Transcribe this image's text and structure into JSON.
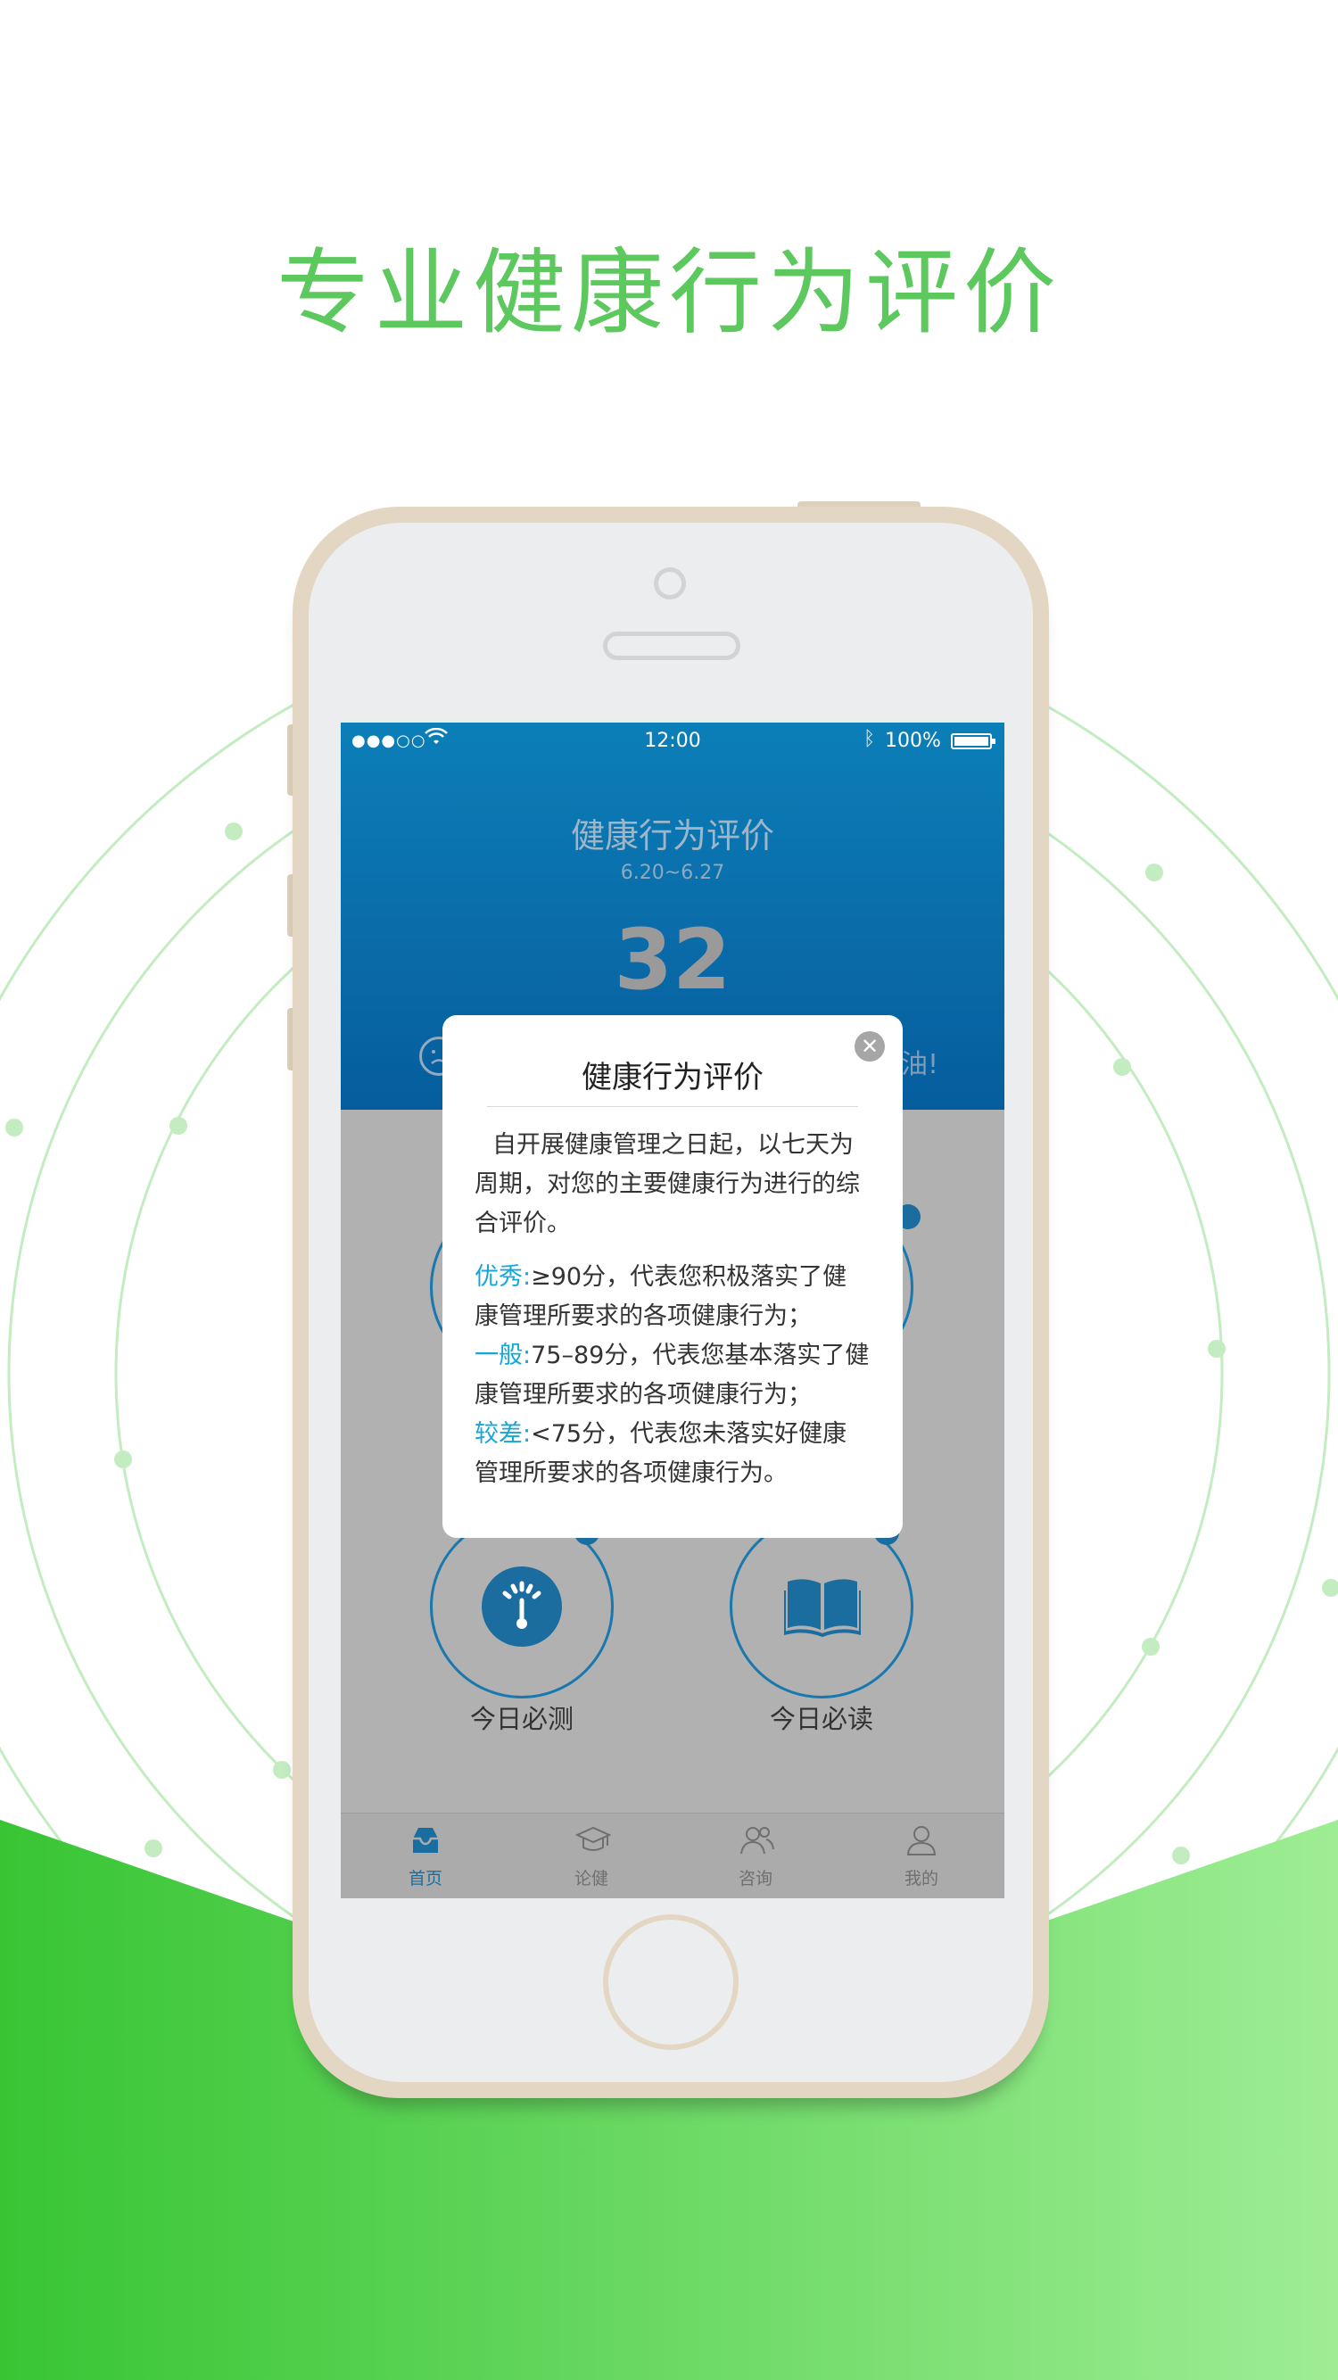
{
  "headline": "专业健康行为评价",
  "status_bar": {
    "signal": "●●●○○",
    "time": "12:00",
    "battery": "100%"
  },
  "app_header": {
    "title": "健康行为评价",
    "date_range": "6.20~6.27",
    "score": "32",
    "trailing_text": "油!"
  },
  "dialog": {
    "title": "健康行为评价",
    "intro": "自开展健康管理之日起，以七天为周期，对您的主要健康行为进行的综合评价。",
    "grades": [
      {
        "label": "优秀:",
        "text": "≥90分，代表您积极落实了健康管理所要求的各项健康行为；"
      },
      {
        "label": "一般:",
        "text": "75–89分，代表您基本落实了健康管理所要求的各项健康行为；"
      },
      {
        "label": "较差:",
        "text": "<75分，代表您未落实好健康管理所要求的各项健康行为。"
      }
    ]
  },
  "tasks": [
    {
      "label": "今日必测",
      "icon": "gauge-icon"
    },
    {
      "label": "今日必读",
      "icon": "book-icon"
    }
  ],
  "tabbar": [
    {
      "label": "首页",
      "icon": "home-inbox-icon",
      "active": true
    },
    {
      "label": "论健",
      "icon": "graduation-cap-icon",
      "active": false
    },
    {
      "label": "咨询",
      "icon": "consult-people-icon",
      "active": false
    },
    {
      "label": "我的",
      "icon": "user-icon",
      "active": false
    }
  ],
  "colors": {
    "headline_green": "#5cc85e",
    "header_blue": "#0a6aa8",
    "grade_label_blue": "#17a6d8",
    "bottom_green_dark": "#38c534",
    "bottom_green_light": "#9eed94"
  }
}
